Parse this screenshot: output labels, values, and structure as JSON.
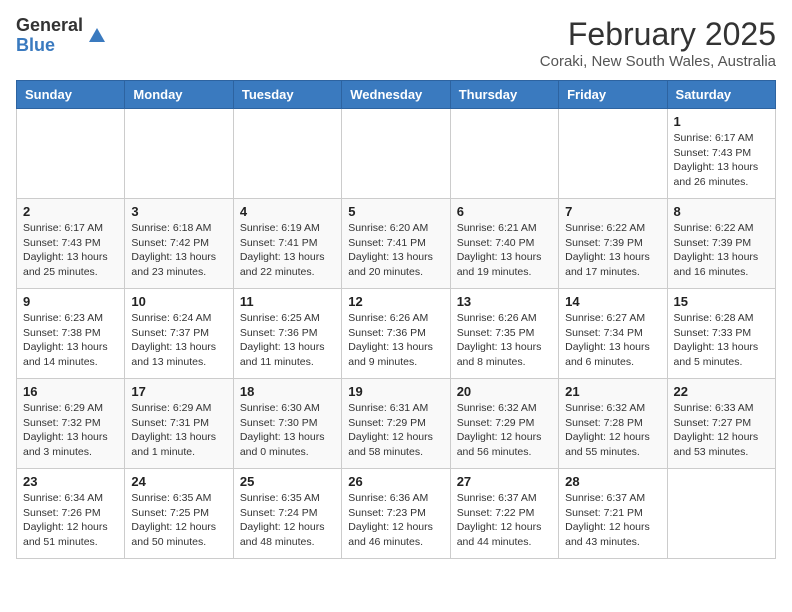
{
  "logo": {
    "line1": "General",
    "line2": "Blue"
  },
  "title": "February 2025",
  "location": "Coraki, New South Wales, Australia",
  "weekdays": [
    "Sunday",
    "Monday",
    "Tuesday",
    "Wednesday",
    "Thursday",
    "Friday",
    "Saturday"
  ],
  "weeks": [
    [
      {
        "day": "",
        "info": ""
      },
      {
        "day": "",
        "info": ""
      },
      {
        "day": "",
        "info": ""
      },
      {
        "day": "",
        "info": ""
      },
      {
        "day": "",
        "info": ""
      },
      {
        "day": "",
        "info": ""
      },
      {
        "day": "1",
        "info": "Sunrise: 6:17 AM\nSunset: 7:43 PM\nDaylight: 13 hours\nand 26 minutes."
      }
    ],
    [
      {
        "day": "2",
        "info": "Sunrise: 6:17 AM\nSunset: 7:43 PM\nDaylight: 13 hours\nand 25 minutes."
      },
      {
        "day": "3",
        "info": "Sunrise: 6:18 AM\nSunset: 7:42 PM\nDaylight: 13 hours\nand 23 minutes."
      },
      {
        "day": "4",
        "info": "Sunrise: 6:19 AM\nSunset: 7:41 PM\nDaylight: 13 hours\nand 22 minutes."
      },
      {
        "day": "5",
        "info": "Sunrise: 6:20 AM\nSunset: 7:41 PM\nDaylight: 13 hours\nand 20 minutes."
      },
      {
        "day": "6",
        "info": "Sunrise: 6:21 AM\nSunset: 7:40 PM\nDaylight: 13 hours\nand 19 minutes."
      },
      {
        "day": "7",
        "info": "Sunrise: 6:22 AM\nSunset: 7:39 PM\nDaylight: 13 hours\nand 17 minutes."
      },
      {
        "day": "8",
        "info": "Sunrise: 6:22 AM\nSunset: 7:39 PM\nDaylight: 13 hours\nand 16 minutes."
      }
    ],
    [
      {
        "day": "9",
        "info": "Sunrise: 6:23 AM\nSunset: 7:38 PM\nDaylight: 13 hours\nand 14 minutes."
      },
      {
        "day": "10",
        "info": "Sunrise: 6:24 AM\nSunset: 7:37 PM\nDaylight: 13 hours\nand 13 minutes."
      },
      {
        "day": "11",
        "info": "Sunrise: 6:25 AM\nSunset: 7:36 PM\nDaylight: 13 hours\nand 11 minutes."
      },
      {
        "day": "12",
        "info": "Sunrise: 6:26 AM\nSunset: 7:36 PM\nDaylight: 13 hours\nand 9 minutes."
      },
      {
        "day": "13",
        "info": "Sunrise: 6:26 AM\nSunset: 7:35 PM\nDaylight: 13 hours\nand 8 minutes."
      },
      {
        "day": "14",
        "info": "Sunrise: 6:27 AM\nSunset: 7:34 PM\nDaylight: 13 hours\nand 6 minutes."
      },
      {
        "day": "15",
        "info": "Sunrise: 6:28 AM\nSunset: 7:33 PM\nDaylight: 13 hours\nand 5 minutes."
      }
    ],
    [
      {
        "day": "16",
        "info": "Sunrise: 6:29 AM\nSunset: 7:32 PM\nDaylight: 13 hours\nand 3 minutes."
      },
      {
        "day": "17",
        "info": "Sunrise: 6:29 AM\nSunset: 7:31 PM\nDaylight: 13 hours\nand 1 minute."
      },
      {
        "day": "18",
        "info": "Sunrise: 6:30 AM\nSunset: 7:30 PM\nDaylight: 13 hours\nand 0 minutes."
      },
      {
        "day": "19",
        "info": "Sunrise: 6:31 AM\nSunset: 7:29 PM\nDaylight: 12 hours\nand 58 minutes."
      },
      {
        "day": "20",
        "info": "Sunrise: 6:32 AM\nSunset: 7:29 PM\nDaylight: 12 hours\nand 56 minutes."
      },
      {
        "day": "21",
        "info": "Sunrise: 6:32 AM\nSunset: 7:28 PM\nDaylight: 12 hours\nand 55 minutes."
      },
      {
        "day": "22",
        "info": "Sunrise: 6:33 AM\nSunset: 7:27 PM\nDaylight: 12 hours\nand 53 minutes."
      }
    ],
    [
      {
        "day": "23",
        "info": "Sunrise: 6:34 AM\nSunset: 7:26 PM\nDaylight: 12 hours\nand 51 minutes."
      },
      {
        "day": "24",
        "info": "Sunrise: 6:35 AM\nSunset: 7:25 PM\nDaylight: 12 hours\nand 50 minutes."
      },
      {
        "day": "25",
        "info": "Sunrise: 6:35 AM\nSunset: 7:24 PM\nDaylight: 12 hours\nand 48 minutes."
      },
      {
        "day": "26",
        "info": "Sunrise: 6:36 AM\nSunset: 7:23 PM\nDaylight: 12 hours\nand 46 minutes."
      },
      {
        "day": "27",
        "info": "Sunrise: 6:37 AM\nSunset: 7:22 PM\nDaylight: 12 hours\nand 44 minutes."
      },
      {
        "day": "28",
        "info": "Sunrise: 6:37 AM\nSunset: 7:21 PM\nDaylight: 12 hours\nand 43 minutes."
      },
      {
        "day": "",
        "info": ""
      }
    ]
  ]
}
